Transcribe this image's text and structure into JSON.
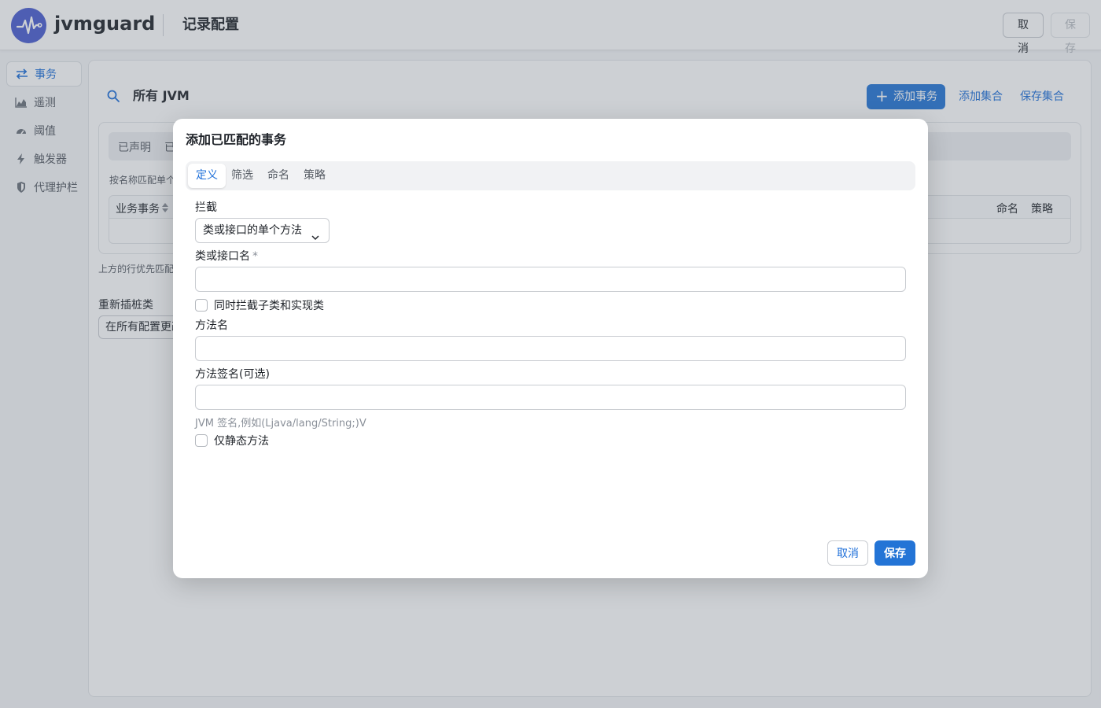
{
  "header": {
    "app_name": "jvmguard",
    "page_title": "记录配置",
    "cancel_label": "取消",
    "save_label": "保存"
  },
  "sidebar": {
    "items": [
      {
        "label": "事务",
        "icon": "transfer-arrows-icon",
        "active": true
      },
      {
        "label": "遥测",
        "icon": "area-chart-icon",
        "active": false
      },
      {
        "label": "阈值",
        "icon": "gauge-icon",
        "active": false
      },
      {
        "label": "触发器",
        "icon": "lightning-icon",
        "active": false
      },
      {
        "label": "代理护栏",
        "icon": "shield-icon",
        "active": false
      }
    ]
  },
  "main": {
    "scope_title": "所有 JVM",
    "add_transaction_label": "添加事务",
    "add_set_label": "添加集合",
    "save_set_label": "保存集合",
    "tabs": [
      "已声明",
      "已"
    ],
    "hint": "按名称匹配单个方",
    "table_headers": [
      "业务事务",
      "命名",
      "策略"
    ],
    "note": "上方的行优先匹配。",
    "retransform_label": "重新插桩类",
    "retransform_value": "在所有配置更改"
  },
  "modal": {
    "title": "添加已匹配的事务",
    "tabs": [
      {
        "label": "定义",
        "active": true
      },
      {
        "label": "筛选",
        "active": false
      },
      {
        "label": "命名",
        "active": false
      },
      {
        "label": "策略",
        "active": false
      }
    ],
    "intercept_label": "拦截",
    "intercept_value": "类或接口的单个方法",
    "class_name_label": "类或接口名",
    "class_name_required": "*",
    "class_name_value": "",
    "subclasses_label": "同时拦截子类和实现类",
    "method_name_label": "方法名",
    "method_name_value": "",
    "signature_label": "方法签名(可选)",
    "signature_value": "",
    "signature_help": "JVM 签名,例如(Ljava/lang/String;)V",
    "static_only_label": "仅静态方法",
    "cancel_label": "取消",
    "save_label": "保存"
  },
  "colors": {
    "accent": "#2374d6",
    "logo": "#4a5cd0"
  }
}
